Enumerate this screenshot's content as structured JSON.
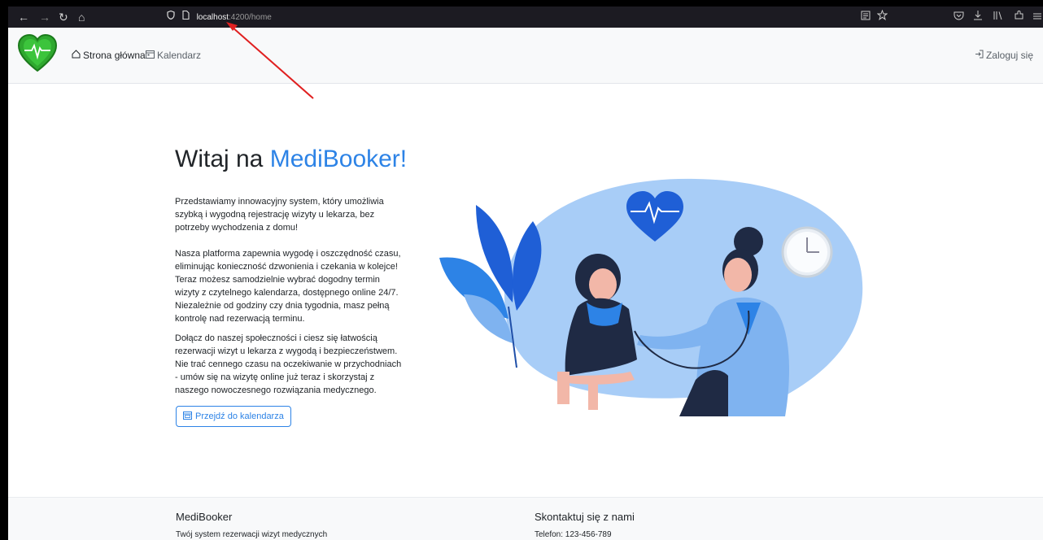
{
  "browser": {
    "back_glyph": "←",
    "forward_glyph": "→",
    "reload_glyph": "↻",
    "home_glyph": "⌂",
    "url_host": "localhost",
    "url_path": ":4200/home",
    "icons": [
      "shield-icon",
      "page-icon",
      "reader-icon",
      "star-icon",
      "pocket-icon",
      "download-icon",
      "library-icon",
      "extensions-icon",
      "menu-icon"
    ]
  },
  "navbar": {
    "home_label": "Strona główna",
    "calendar_label": "Kalendarz",
    "login_label": "Zaloguj się"
  },
  "hero": {
    "title_prefix": "Witaj na ",
    "title_brand": "MediBooker!",
    "paragraph1": "Przedstawiamy innowacyjny system, który umożliwia szybką i wygodną rejestrację wizyty u lekarza, bez potrzeby wychodzenia z domu!",
    "paragraph2": "Nasza platforma zapewnia wygodę i oszczędność czasu, eliminując konieczność dzwonienia i czekania w kolejce! Teraz możesz samodzielnie wybrać dogodny termin wizyty z czytelnego kalendarza, dostępnego online 24/7. Niezależnie od godziny czy dnia tygodnia, masz pełną kontrolę nad rezerwacją terminu.",
    "paragraph3": "Dołącz do naszej społeczności i ciesz się łatwością rezerwacji wizyt u lekarza z wygodą i bezpieczeństwem. Nie trać cennego czasu na oczekiwanie w przychodniach - umów się na wizytę online już teraz i skorzystaj z naszego nowoczesnego rozwiązania medycznego.",
    "cta_label": "Przejdź do kalendarza"
  },
  "footer": {
    "brand_title": "MediBooker",
    "brand_text": "Twój system rezerwacji wizyt medycznych",
    "contact_title": "Skontaktuj się z nami",
    "contact_phone": "Telefon: 123-456-789"
  },
  "colors": {
    "brand_blue": "#2d83e6",
    "logo_green": "#2fa82f",
    "annotation_arrow": "#e02020"
  }
}
